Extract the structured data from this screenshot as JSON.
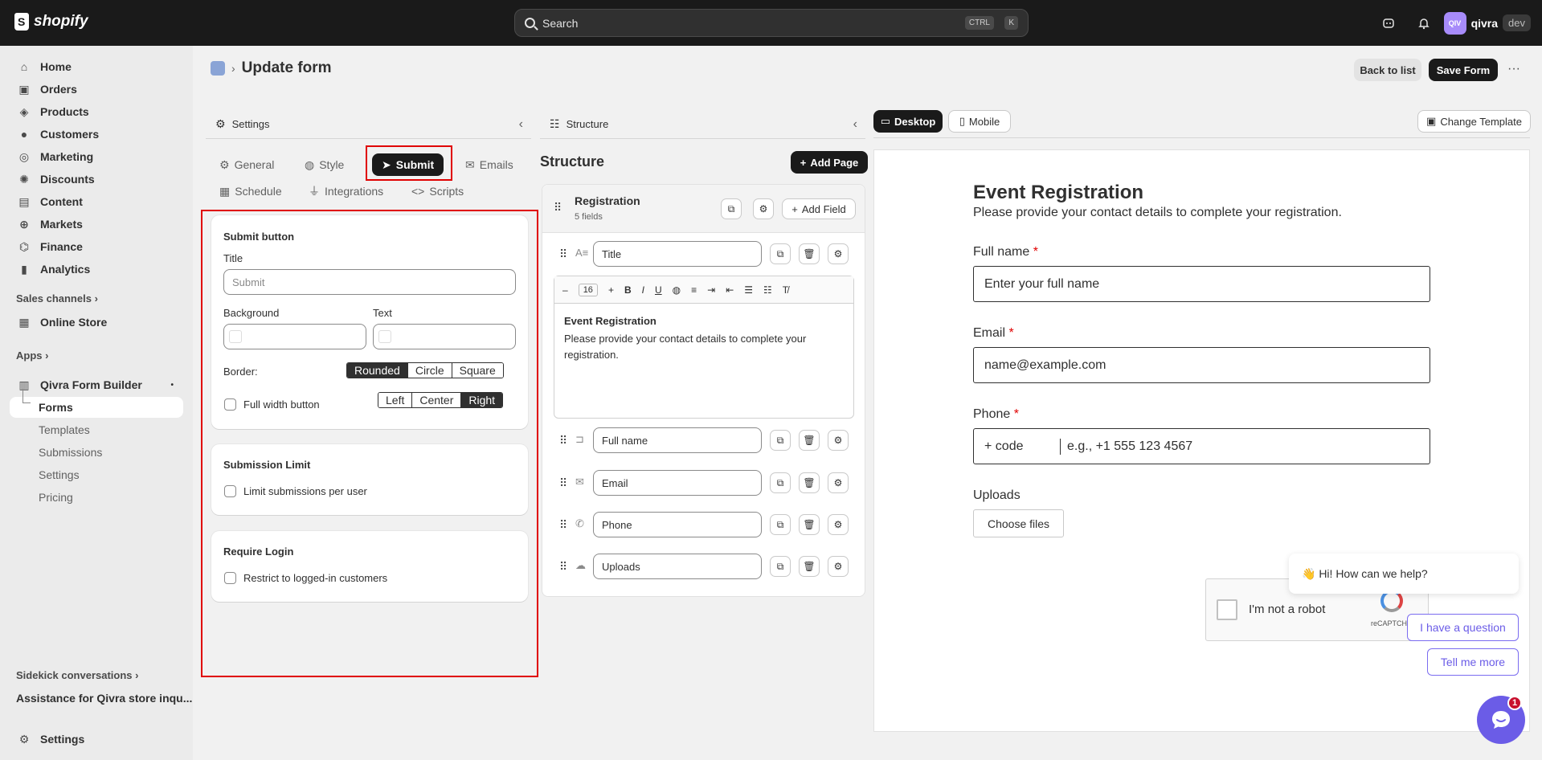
{
  "topbar": {
    "brand": "shopify",
    "search_placeholder": "Search",
    "shortcut_ctrl": "CTRL",
    "shortcut_k": "K",
    "avatar_initials": "QIV",
    "store_name": "qivra",
    "store_tag": "dev"
  },
  "sidebar": {
    "items": [
      {
        "label": "Home",
        "icon": "home-icon"
      },
      {
        "label": "Orders",
        "icon": "orders-icon"
      },
      {
        "label": "Products",
        "icon": "tag-icon"
      },
      {
        "label": "Customers",
        "icon": "person-icon"
      },
      {
        "label": "Marketing",
        "icon": "target-icon"
      },
      {
        "label": "Discounts",
        "icon": "discount-icon"
      },
      {
        "label": "Content",
        "icon": "content-icon"
      },
      {
        "label": "Markets",
        "icon": "globe-icon"
      },
      {
        "label": "Finance",
        "icon": "bank-icon"
      },
      {
        "label": "Analytics",
        "icon": "chart-icon"
      }
    ],
    "sales_channels": "Sales channels",
    "online_store": "Online Store",
    "apps": "Apps",
    "app_name": "Qivra Form Builder",
    "app_sub": [
      "Forms",
      "Templates",
      "Submissions",
      "Settings",
      "Pricing"
    ],
    "sidekick": "Sidekick conversations",
    "sidekick_item": "Assistance for Qivra store inqu...",
    "settings": "Settings"
  },
  "header": {
    "title": "Update form",
    "back_label": "Back to list",
    "save_label": "Save Form",
    "more": "···"
  },
  "settings_panel": {
    "title": "Settings",
    "tabs": [
      "General",
      "Style",
      "Submit",
      "Emails",
      "Schedule",
      "Integrations",
      "Scripts"
    ],
    "active_tab": "Submit",
    "submit_button": {
      "heading": "Submit button",
      "title_label": "Title",
      "title_placeholder": "Submit",
      "background_label": "Background",
      "text_label": "Text",
      "border_label": "Border:",
      "border_options": [
        "Rounded",
        "Circle",
        "Square"
      ],
      "border_selected": "Rounded",
      "full_width_label": "Full width button",
      "align_options": [
        "Left",
        "Center",
        "Right"
      ],
      "align_selected": "Right"
    },
    "submission_limit": {
      "heading": "Submission Limit",
      "checkbox": "Limit submissions per user"
    },
    "require_login": {
      "heading": "Require Login",
      "checkbox": "Restrict to logged-in customers"
    }
  },
  "structure_panel": {
    "title": "Structure",
    "heading": "Structure",
    "add_page": "Add Page",
    "page_name": "Registration",
    "page_count": "5 fields",
    "add_field": "Add Field",
    "font_size": "16",
    "editor_title": "Event Registration",
    "editor_body": "Please provide your contact details to complete your registration.",
    "fields": [
      "Title",
      "Full name",
      "Email",
      "Phone",
      "Uploads"
    ]
  },
  "preview": {
    "desktop": "Desktop",
    "mobile": "Mobile",
    "change_template": "Change Template",
    "form_title": "Event Registration",
    "form_subtitle": "Please provide your contact details to complete your registration.",
    "fullname_label": "Full name",
    "fullname_placeholder": "Enter your full name",
    "email_label": "Email",
    "email_placeholder": "name@example.com",
    "phone_label": "Phone",
    "phone_code": "+ code",
    "phone_placeholder": "e.g., +1 555 123 4567",
    "uploads_label": "Uploads",
    "choose_files": "Choose files",
    "captcha_text": "I'm not a robot",
    "captcha_brand": "reCAPTCHA",
    "required_mark": "*"
  },
  "chat": {
    "greeting": "👋 Hi! How can we help?",
    "option1": "I have a question",
    "option2": "Tell me more",
    "badge": "1"
  }
}
